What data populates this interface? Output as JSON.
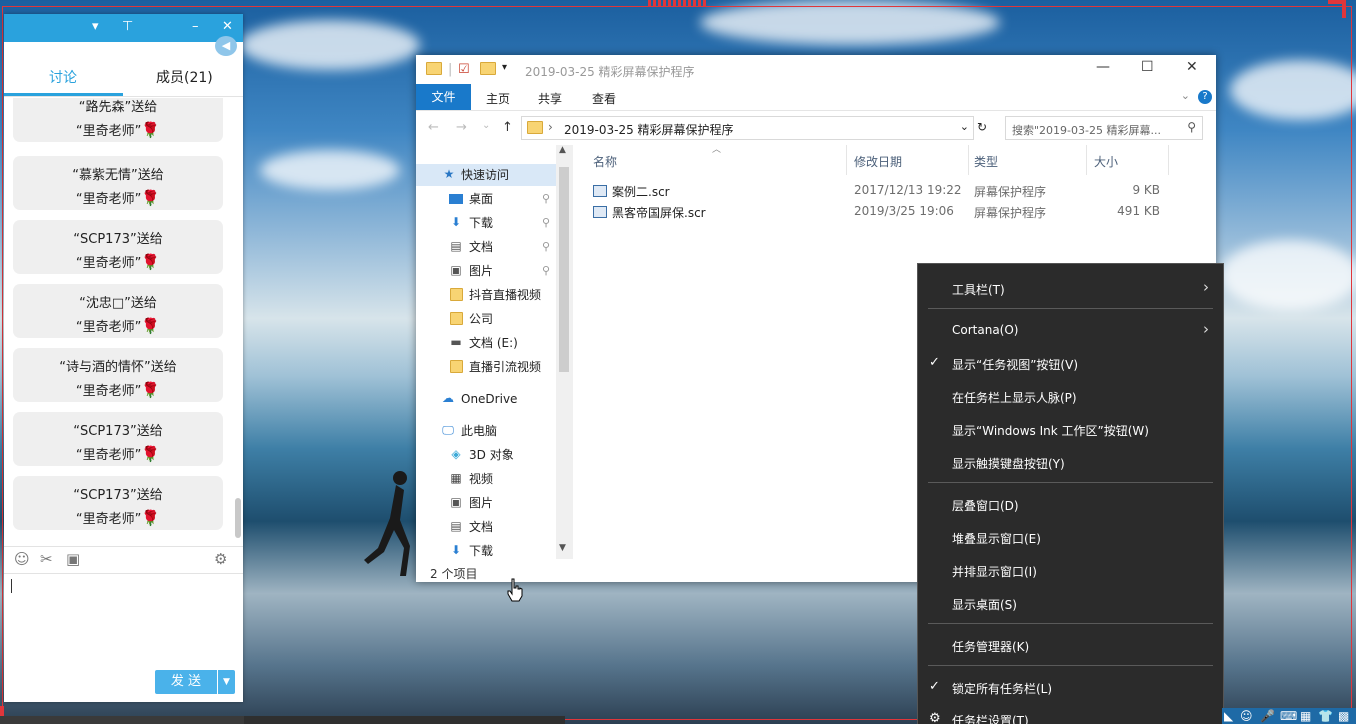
{
  "chat": {
    "tabs": [
      "讨论",
      "成员(21)"
    ],
    "gifts": [
      {
        "from": "“路先森”送给",
        "to": "“里奇老师”"
      },
      {
        "from": "“慕紫无情”送给",
        "to": "“里奇老师”"
      },
      {
        "from": "“SCP173”送给",
        "to": "“里奇老师”"
      },
      {
        "from": "“沈忠□”送给",
        "to": "“里奇老师”"
      },
      {
        "from": "“诗与酒的情怀”送给",
        "to": "“里奇老师”"
      },
      {
        "from": "“SCP173”送给",
        "to": "“里奇老师”"
      },
      {
        "from": "“SCP173”送给",
        "to": "“里奇老师”"
      }
    ],
    "send_label": "发 送",
    "accent_color": "#2aa2dd"
  },
  "explorer": {
    "title": "2019-03-25 精彩屏幕保护程序",
    "ribbon_tabs": [
      "文件",
      "主页",
      "共享",
      "查看"
    ],
    "address": "2019-03-25 精彩屏幕保护程序",
    "search_placeholder": "搜索\"2019-03-25 精彩屏幕...",
    "nav_items": [
      {
        "label": "快速访问",
        "icon": "star-icon",
        "pinned": false
      },
      {
        "label": "桌面",
        "icon": "desktop-icon",
        "pinned": true
      },
      {
        "label": "下载",
        "icon": "download-icon",
        "pinned": true
      },
      {
        "label": "文档",
        "icon": "document-icon",
        "pinned": true
      },
      {
        "label": "图片",
        "icon": "picture-icon",
        "pinned": true
      },
      {
        "label": "抖音直播视频",
        "icon": "folder-icon",
        "pinned": false
      },
      {
        "label": "公司",
        "icon": "folder-icon",
        "pinned": false
      },
      {
        "label": "文档 (E:)",
        "icon": "drive-icon",
        "pinned": false
      },
      {
        "label": "直播引流视频",
        "icon": "folder-icon",
        "pinned": false
      },
      {
        "label": "OneDrive",
        "icon": "cloud-icon",
        "pinned": false
      },
      {
        "label": "此电脑",
        "icon": "computer-icon",
        "pinned": false
      },
      {
        "label": "3D 对象",
        "icon": "cube-icon",
        "pinned": false
      },
      {
        "label": "视频",
        "icon": "video-icon",
        "pinned": false
      },
      {
        "label": "图片",
        "icon": "picture-icon",
        "pinned": false
      },
      {
        "label": "文档",
        "icon": "document-icon",
        "pinned": false
      },
      {
        "label": "下载",
        "icon": "download-icon",
        "pinned": false
      }
    ],
    "columns": [
      "名称",
      "修改日期",
      "类型",
      "大小"
    ],
    "files": [
      {
        "name": "案例二.scr",
        "date": "2017/12/13 19:22",
        "type": "屏幕保护程序",
        "size": "9 KB"
      },
      {
        "name": "黑客帝国屏保.scr",
        "date": "2019/3/25 19:06",
        "type": "屏幕保护程序",
        "size": "491 KB"
      }
    ],
    "status": "2 个项目",
    "accent_color": "#1979ca"
  },
  "context_menu": {
    "items": [
      {
        "label": "工具栏(T)",
        "checked": false,
        "submenu": true,
        "icon": ""
      },
      {
        "label": "Cortana(O)",
        "checked": false,
        "submenu": true,
        "icon": ""
      },
      {
        "label": "显示“任务视图”按钮(V)",
        "checked": true,
        "submenu": false,
        "icon": ""
      },
      {
        "label": "在任务栏上显示人脉(P)",
        "checked": false,
        "submenu": false,
        "icon": ""
      },
      {
        "label": "显示“Windows Ink 工作区”按钮(W)",
        "checked": false,
        "submenu": false,
        "icon": ""
      },
      {
        "label": "显示触摸键盘按钮(Y)",
        "checked": false,
        "submenu": false,
        "icon": ""
      },
      {
        "label": "层叠窗口(D)",
        "checked": false,
        "submenu": false,
        "icon": ""
      },
      {
        "label": "堆叠显示窗口(E)",
        "checked": false,
        "submenu": false,
        "icon": ""
      },
      {
        "label": "并排显示窗口(I)",
        "checked": false,
        "submenu": false,
        "icon": ""
      },
      {
        "label": "显示桌面(S)",
        "checked": false,
        "submenu": false,
        "icon": ""
      },
      {
        "label": "任务管理器(K)",
        "checked": false,
        "submenu": false,
        "icon": ""
      },
      {
        "label": "锁定所有任务栏(L)",
        "checked": true,
        "submenu": false,
        "icon": ""
      },
      {
        "label": "任务栏设置(T)",
        "checked": false,
        "submenu": false,
        "icon": "gear-icon"
      }
    ]
  }
}
